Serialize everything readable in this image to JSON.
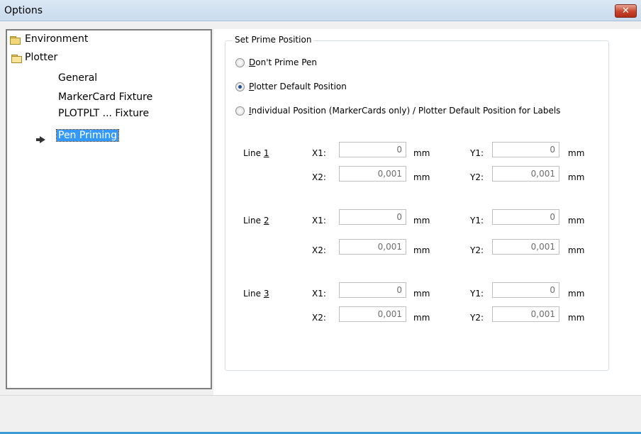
{
  "window": {
    "title": "Options",
    "close_symbol": "✕"
  },
  "tree": {
    "environment": "Environment",
    "plotter": "Plotter",
    "general": "General",
    "markercard": "MarkerCard Fixture",
    "plotplt": "PLOTPLT ... Fixture",
    "pen_priming": "Pen Priming"
  },
  "group": {
    "title": "Set Prime Position",
    "options": [
      {
        "key": "D",
        "rest": "on't Prime Pen",
        "checked": false
      },
      {
        "key": "P",
        "rest": "lotter Default Position",
        "checked": true
      },
      {
        "key": "I",
        "rest": "ndividual Position (MarkerCards only) / Plotter Default Position for Labels",
        "checked": false
      }
    ]
  },
  "lines": [
    {
      "label": "Line ",
      "num": "1",
      "x1": "0",
      "x2": "0,001",
      "y1": "0",
      "y2": "0,001"
    },
    {
      "label": "Line ",
      "num": "2",
      "x1": "0",
      "x2": "0,001",
      "y1": "0",
      "y2": "0,001"
    },
    {
      "label": "Line ",
      "num": "3",
      "x1": "0",
      "x2": "0,001",
      "y1": "0",
      "y2": "0,001"
    }
  ],
  "labels": {
    "x1": "X1:",
    "x2": "X2:",
    "y1": "Y1:",
    "y2": "Y2:",
    "unit": "mm"
  }
}
